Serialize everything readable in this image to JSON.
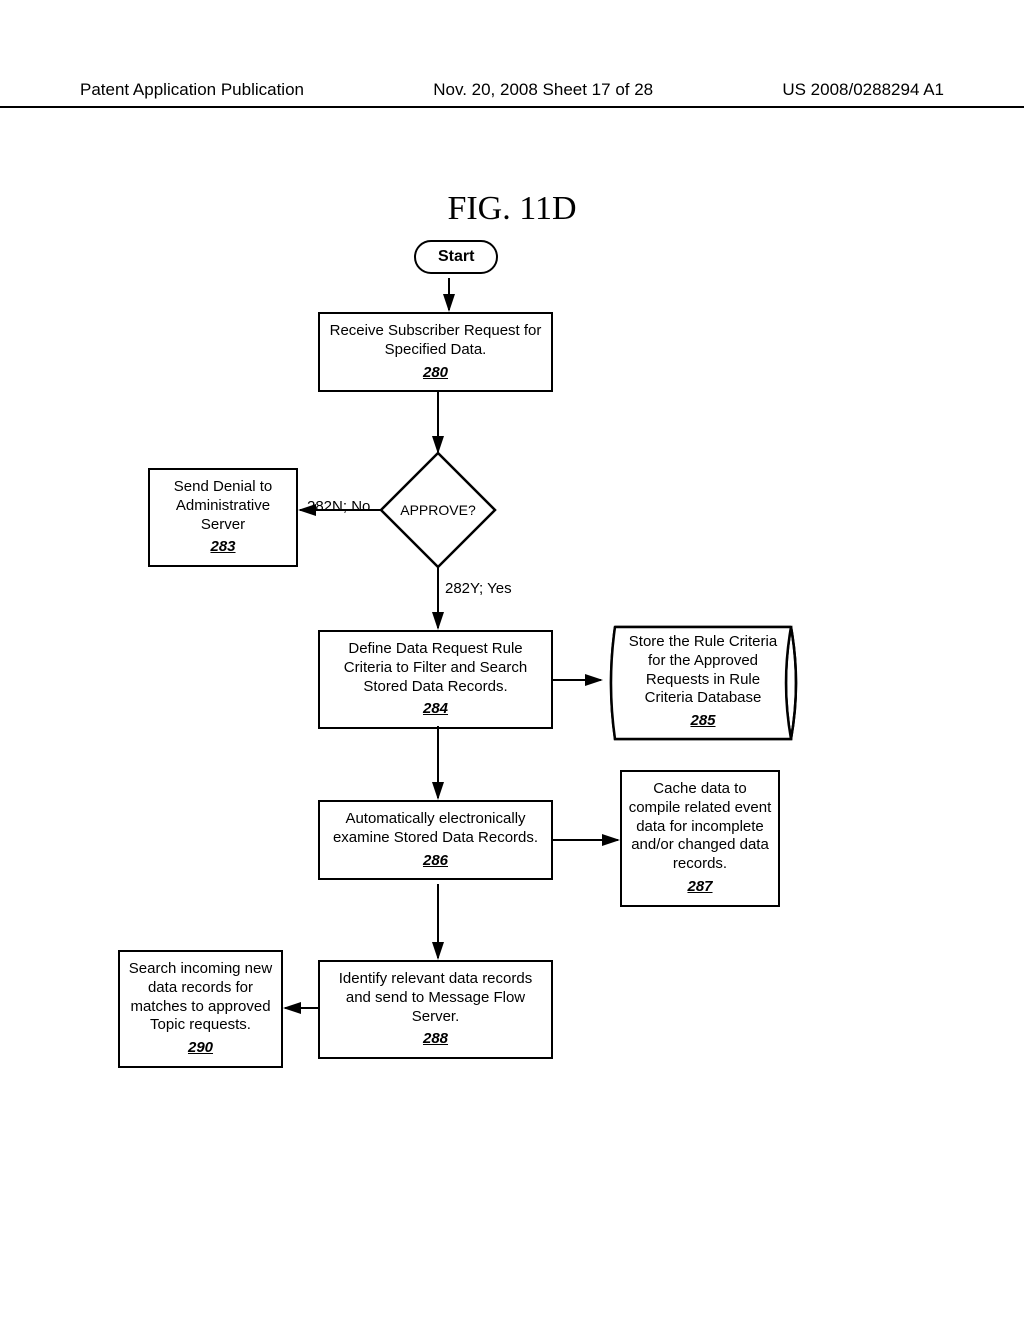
{
  "header": {
    "left": "Patent Application Publication",
    "mid": "Nov. 20, 2008  Sheet 17 of 28",
    "right": "US 2008/0288294 A1"
  },
  "figure_title": "FIG. 11D",
  "nodes": {
    "start": "Start",
    "n280": {
      "text": "Receive Subscriber Request for Specified Data.",
      "ref": "280"
    },
    "decision": "APPROVE?",
    "edge_no": "282N; No",
    "edge_yes": "282Y; Yes",
    "n283": {
      "text": "Send Denial to Administrative Server",
      "ref": "283"
    },
    "n284": {
      "text": "Define Data Request Rule Criteria to Filter and Search Stored Data Records.",
      "ref": "284"
    },
    "n285": {
      "text": "Store the Rule Criteria for the Approved Requests in Rule Criteria Database",
      "ref": "285"
    },
    "n286": {
      "text": "Automatically electronically examine Stored Data Records.",
      "ref": "286"
    },
    "n287": {
      "text": "Cache data to compile related event data for incomplete and/or changed data records.",
      "ref": "287"
    },
    "n288": {
      "text": "Identify relevant data records and send to Message Flow Server.",
      "ref": "288"
    },
    "n290": {
      "text": "Search incoming new data records for matches to approved Topic requests.",
      "ref": "290"
    }
  }
}
